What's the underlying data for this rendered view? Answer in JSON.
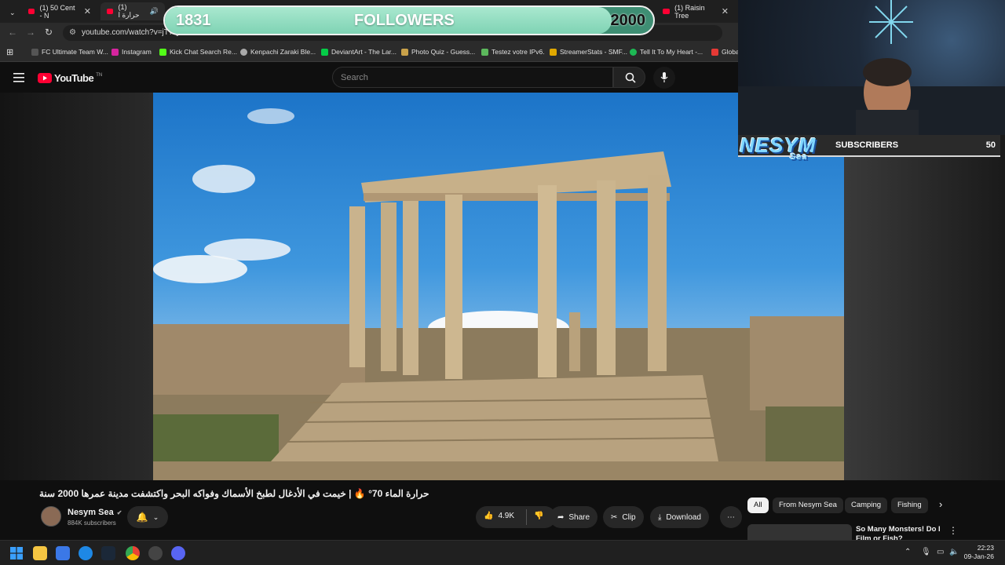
{
  "browser": {
    "tabs": [
      {
        "label": "(1) 50 Cent - N"
      },
      {
        "label": "(1) حرارة ا"
      },
      {
        "label": "(1) Raisin Tree"
      }
    ],
    "url": "youtube.com/watch?v=jT7Q",
    "bookmarks": [
      "FC Ultimate Team W...",
      "Instagram",
      "Kick Chat Search Re...",
      "Kenpachi Zaraki Ble...",
      "DeviantArt - The Lar...",
      "Photo Quiz - Guess...",
      "Testez votre IPv6.",
      "StreamerStats - SMF...",
      "Tell It To My Heart -...",
      "Globa"
    ]
  },
  "followers_overlay": {
    "current": "1831",
    "label": "FOLLOWERS",
    "goal": "2000",
    "progress": 0.915
  },
  "youtube": {
    "logo_text": "YouTube",
    "logo_sup": "TN",
    "search_placeholder": "Search"
  },
  "stream_overlay": {
    "logo_text": "NESYM",
    "logo_sub": "Sea",
    "subs_label": "SUBSCRIBERS",
    "subs_count": "50"
  },
  "video": {
    "title": "حرارة الماء 70° 🔥 | خيمت في الأدغال لطبخ الأسماك وفواكه البحر واكتشفت مدينة عمرها 2000 سنة",
    "channel_name": "Nesym Sea",
    "subscribers": "884K subscribers",
    "likes": "4.9K",
    "share_label": "Share",
    "clip_label": "Clip",
    "download_label": "Download"
  },
  "recommendations": {
    "chips": [
      "All",
      "From Nesym Sea",
      "Camping",
      "Fishing"
    ],
    "first_title": "So Many Monsters! Do I",
    "first_title_line2": "Film or Fish?"
  },
  "taskbar": {
    "time": "22:23",
    "date": "09-Jan-26"
  },
  "colors": {
    "youtube_red": "#ff0033",
    "followers_fill": "#a9e8cf",
    "followers_bg": "#3e8e73"
  }
}
